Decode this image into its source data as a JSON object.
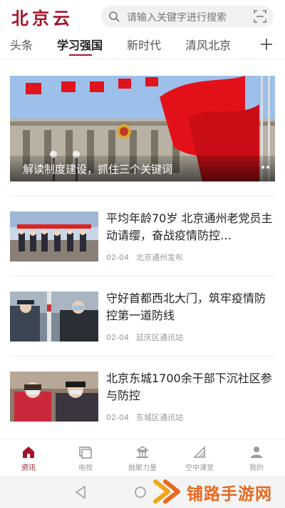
{
  "header": {
    "logo": "北京云",
    "search_placeholder": "请输入关键字进行搜索"
  },
  "tabs": [
    {
      "label": "头条",
      "active": false
    },
    {
      "label": "学习强国",
      "active": true
    },
    {
      "label": "新时代",
      "active": false
    },
    {
      "label": "清风北京",
      "active": false
    }
  ],
  "banner": {
    "caption": "解读制度建设，抓住三个关键词"
  },
  "news": [
    {
      "title": "平均年龄70岁 北京通州老党员主动请缨，奋战疫情防控…",
      "date": "02-04",
      "source": "北京通州发布"
    },
    {
      "title": "守好首都西北大门，筑牢疫情防控第一道防线",
      "date": "02-04",
      "source": "延庆区通讯站"
    },
    {
      "title": "北京东城1700余干部下沉社区参与防控",
      "date": "02-04",
      "source": "东城区通讯站"
    }
  ],
  "bottom_nav": [
    {
      "label": "资讯",
      "icon": "home-icon",
      "active": true
    },
    {
      "label": "电视",
      "icon": "tv-icon",
      "active": false
    },
    {
      "label": "融聚力量",
      "icon": "temple-icon",
      "active": false
    },
    {
      "label": "空中课堂",
      "icon": "classroom-icon",
      "active": false
    },
    {
      "label": "我的",
      "icon": "user-icon",
      "active": false
    }
  ],
  "watermark": {
    "text": "铺路手游网"
  },
  "colors": {
    "accent": "#a3152b",
    "watermark": "#e7691f"
  }
}
